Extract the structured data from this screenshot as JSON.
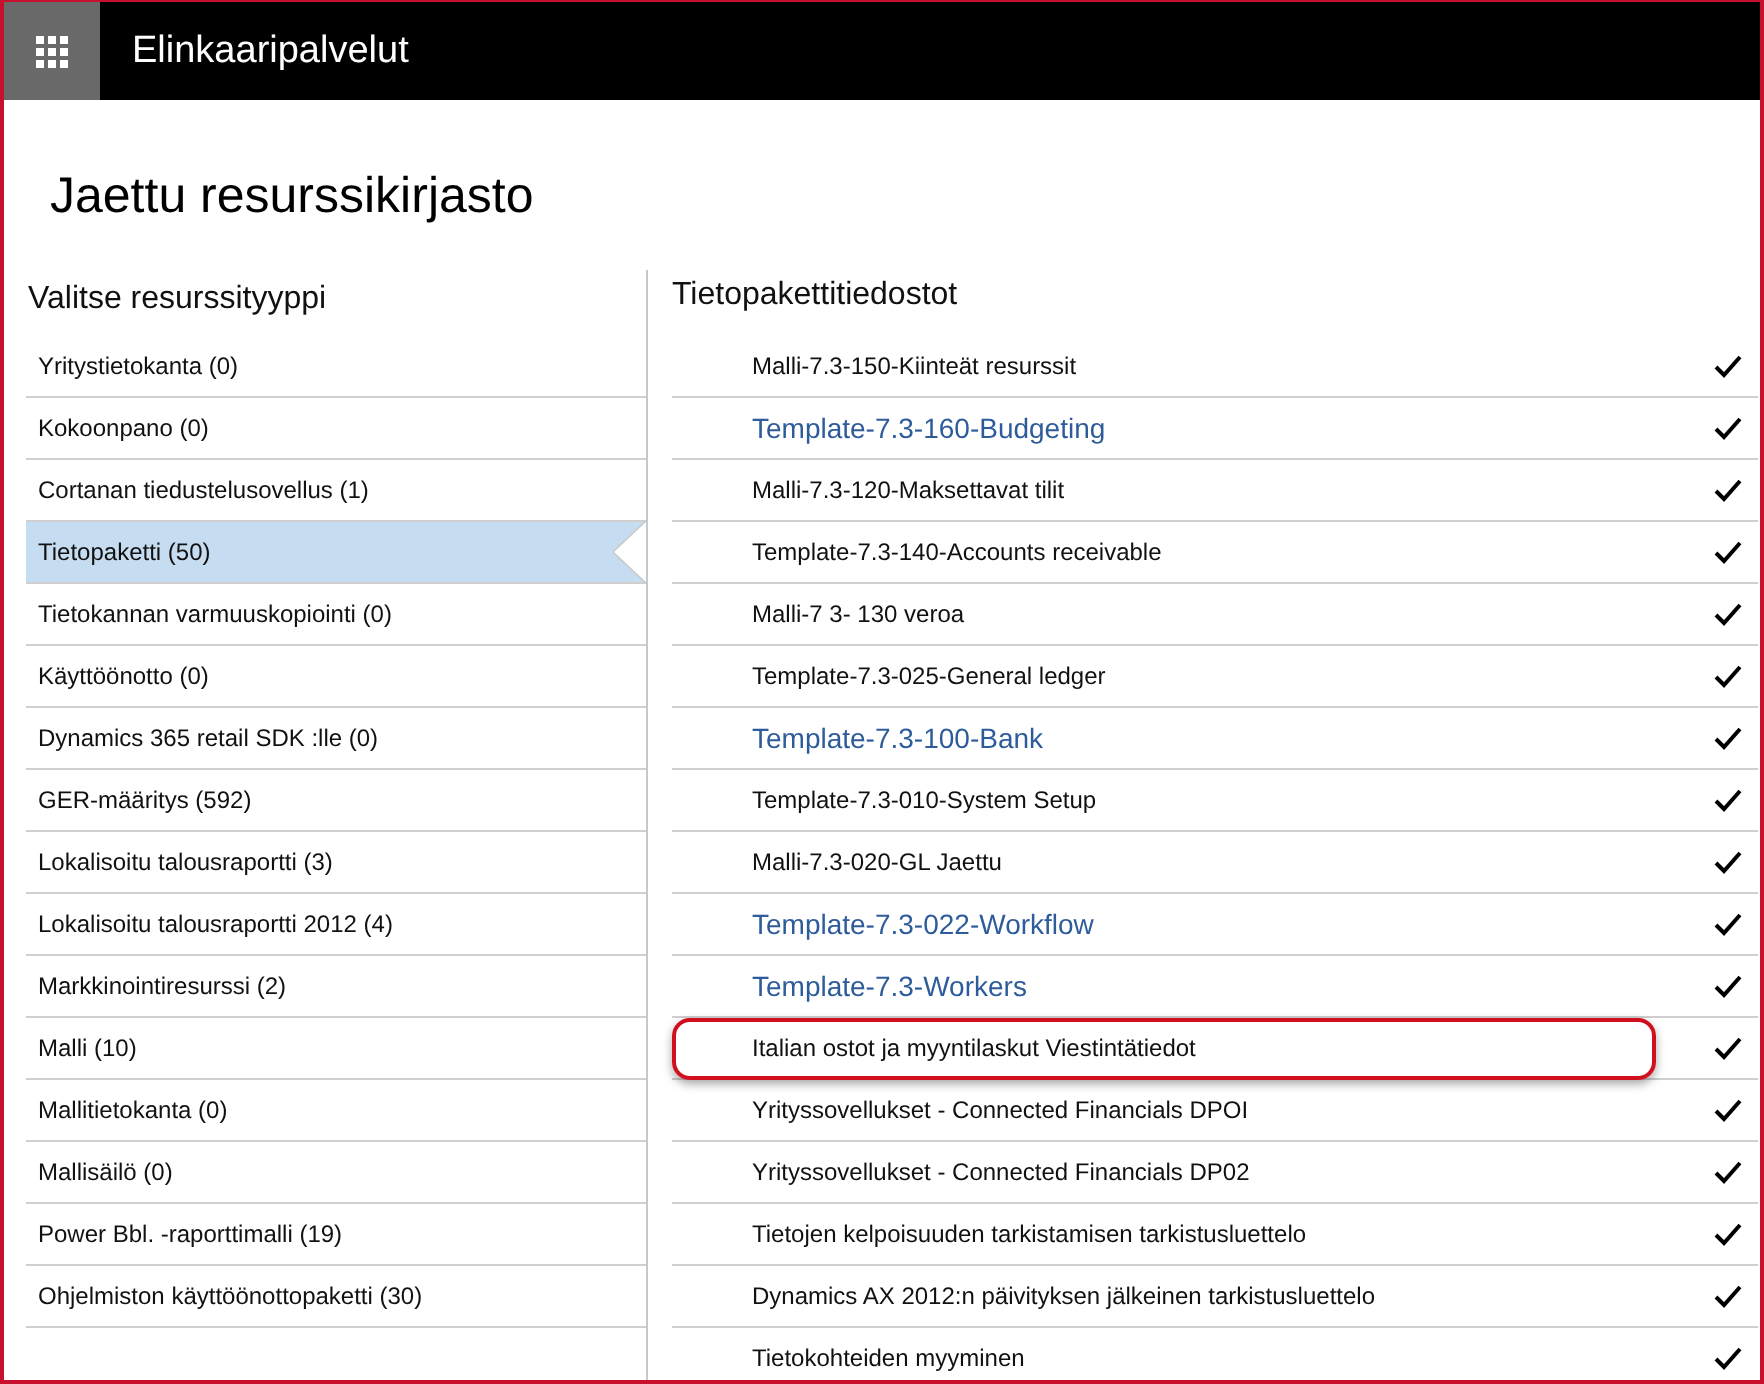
{
  "header": {
    "title": "Elinkaaripalvelut"
  },
  "page_title": "Jaettu resurssikirjasto",
  "resource_types": {
    "heading": "Valitse resurssityyppi",
    "items": [
      {
        "label": "Yritystietokanta (0)",
        "selected": false
      },
      {
        "label": "Kokoonpano (0)",
        "selected": false
      },
      {
        "label": "Cortanan tiedustelusovellus (1)",
        "selected": false
      },
      {
        "label": "Tietopaketti (50)",
        "selected": true
      },
      {
        "label": "Tietokannan varmuuskopiointi (0)",
        "selected": false
      },
      {
        "label": "Käyttöönotto (0)",
        "selected": false
      },
      {
        "label": "Dynamics 365 retail SDK :lle (0)",
        "selected": false
      },
      {
        "label": "GER-määritys (592)",
        "selected": false
      },
      {
        "label": "Lokalisoitu talousraportti (3)",
        "selected": false
      },
      {
        "label": "Lokalisoitu talousraportti 2012 (4)",
        "selected": false
      },
      {
        "label": "Markkinointiresurssi (2)",
        "selected": false
      },
      {
        "label": "Malli (10)",
        "selected": false
      },
      {
        "label": "Mallitietokanta (0)",
        "selected": false
      },
      {
        "label": "Mallisäilö (0)",
        "selected": false
      },
      {
        "label": "Power Bbl. -raporttimalli (19)",
        "selected": false
      },
      {
        "label": "Ohjelmiston käyttöönottopaketti (30)",
        "selected": false
      }
    ]
  },
  "files": {
    "heading": "Tietopakettitiedostot",
    "rows": [
      {
        "name": "Malli-7.3-150-Kiinteät resurssit",
        "kind": "plain",
        "checked": true,
        "highlighted": false
      },
      {
        "name": "Template-7.3-160-Budgeting",
        "kind": "link",
        "checked": true,
        "highlighted": false
      },
      {
        "name": "Malli-7.3-120-Maksettavat tilit",
        "kind": "plain",
        "checked": true,
        "highlighted": false
      },
      {
        "name": "Template-7.3-140-Accounts receivable",
        "kind": "plain",
        "checked": true,
        "highlighted": false
      },
      {
        "name": "Malli-7 3- 130 veroa",
        "kind": "plain",
        "checked": true,
        "highlighted": false
      },
      {
        "name": "Template-7.3-025-General ledger",
        "kind": "plain",
        "checked": true,
        "highlighted": false
      },
      {
        "name": "Template-7.3-100-Bank",
        "kind": "link",
        "checked": true,
        "highlighted": false
      },
      {
        "name": "Template-7.3-010-System Setup",
        "kind": "plain",
        "checked": true,
        "highlighted": false
      },
      {
        "name": "Malli-7.3-020-GL Jaettu",
        "kind": "plain",
        "checked": true,
        "highlighted": false
      },
      {
        "name": "Template-7.3-022-Workflow",
        "kind": "link",
        "checked": true,
        "highlighted": false
      },
      {
        "name": "Template-7.3-Workers",
        "kind": "link",
        "checked": true,
        "highlighted": false
      },
      {
        "name": "Italian ostot ja myyntilaskut Viestintätiedot",
        "kind": "plain",
        "checked": true,
        "highlighted": true
      },
      {
        "name": "Yrityssovellukset - Connected Financials DPOI",
        "kind": "plain",
        "checked": true,
        "highlighted": false
      },
      {
        "name": "Yrityssovellukset - Connected Financials DP02",
        "kind": "plain",
        "checked": true,
        "highlighted": false
      },
      {
        "name": "Tietojen kelpoisuuden tarkistamisen tarkistusluettelo",
        "kind": "plain",
        "checked": true,
        "highlighted": false
      },
      {
        "name": "Dynamics AX 2012:n päivityksen jälkeinen tarkistusluettelo",
        "kind": "plain",
        "checked": true,
        "highlighted": false
      },
      {
        "name": "Tietokohteiden myyminen",
        "kind": "plain",
        "checked": true,
        "highlighted": false
      }
    ]
  }
}
